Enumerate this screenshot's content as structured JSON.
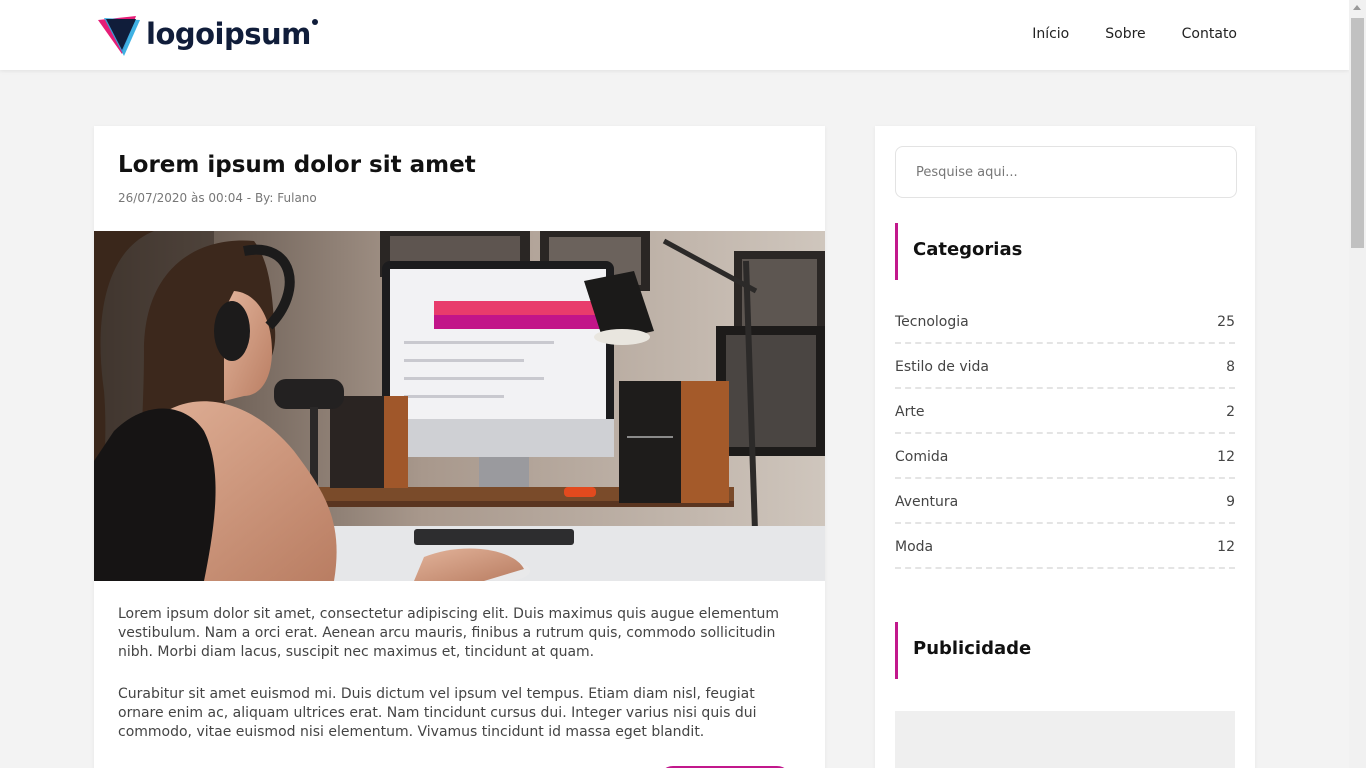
{
  "header": {
    "logo_text": "logoipsum",
    "nav": [
      "Início",
      "Sobre",
      "Contato"
    ]
  },
  "post": {
    "title": "Lorem ipsum dolor sit amet",
    "meta": "26/07/2020 às 00:04 - By: Fulano",
    "paragraphs": [
      "Lorem ipsum dolor sit amet, consectetur adipiscing elit. Duis maximus quis augue elementum vestibulum. Nam a orci erat. Aenean arcu mauris, finibus a rutrum quis, commodo sollicitudin nibh. Morbi diam lacus, suscipit nec maximus et, tincidunt at quam.",
      "Curabitur sit amet euismod mi. Duis dictum vel ipsum vel tempus. Etiam diam nisl, feugiat ornare enim ac, aliquam ultrices erat. Nam tincidunt cursus dui. Integer varius nisi quis dui commodo, vitae euismod nisi elementum. Vivamus tincidunt id massa eget blandit."
    ]
  },
  "sidebar": {
    "search_placeholder": "Pesquise aqui...",
    "categories_title": "Categorias",
    "categories": [
      {
        "name": "Tecnologia",
        "count": "25"
      },
      {
        "name": "Estilo de vida",
        "count": "8"
      },
      {
        "name": "Arte",
        "count": "2"
      },
      {
        "name": "Comida",
        "count": "12"
      },
      {
        "name": "Aventura",
        "count": "9"
      },
      {
        "name": "Moda",
        "count": "12"
      }
    ],
    "ads_title": "Publicidade"
  },
  "colors": {
    "accent": "#c2188c",
    "brand_dark": "#101d3a",
    "background": "#f3f3f3"
  }
}
